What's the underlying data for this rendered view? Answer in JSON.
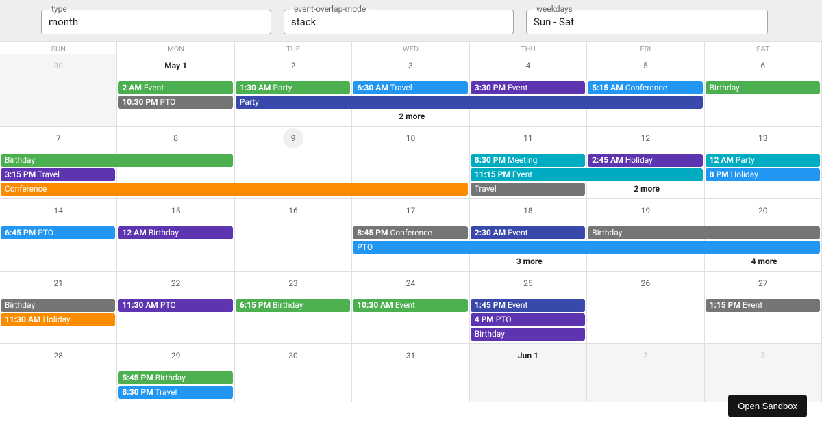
{
  "toolbar": {
    "type": {
      "label": "type",
      "value": "month"
    },
    "overlap": {
      "label": "event-overlap-mode",
      "value": "stack"
    },
    "weekdays": {
      "label": "weekdays",
      "value": "Sun - Sat"
    }
  },
  "button": {
    "sandbox": "Open Sandbox"
  },
  "weekdays": [
    "SUN",
    "MON",
    "TUE",
    "WED",
    "THU",
    "FRI",
    "SAT"
  ],
  "weeks": [
    {
      "days": [
        "30",
        "May 1",
        "2",
        "3",
        "4",
        "5",
        "6"
      ],
      "outside": [
        true,
        false,
        false,
        false,
        false,
        false,
        false
      ],
      "first": 1
    },
    {
      "days": [
        "7",
        "8",
        "9",
        "10",
        "11",
        "12",
        "13"
      ],
      "today": 2
    },
    {
      "days": [
        "14",
        "15",
        "16",
        "17",
        "18",
        "19",
        "20"
      ]
    },
    {
      "days": [
        "21",
        "22",
        "23",
        "24",
        "25",
        "26",
        "27"
      ]
    },
    {
      "days": [
        "28",
        "29",
        "30",
        "31",
        "Jun 1",
        "2",
        "3"
      ],
      "outside": [
        false,
        false,
        false,
        false,
        true,
        true,
        true
      ],
      "first": 4
    }
  ],
  "events": {
    "w0": [
      {
        "row": 0,
        "col": 1,
        "span": 1,
        "color": "green",
        "time": "2 AM",
        "title": "Event"
      },
      {
        "row": 0,
        "col": 2,
        "span": 1,
        "color": "green",
        "time": "1:30 AM",
        "title": "Party"
      },
      {
        "row": 0,
        "col": 3,
        "span": 1,
        "color": "blue2",
        "time": "6:30 AM",
        "title": "Travel"
      },
      {
        "row": 0,
        "col": 4,
        "span": 1,
        "color": "deep",
        "time": "3:30 PM",
        "title": "Event"
      },
      {
        "row": 0,
        "col": 5,
        "span": 1,
        "color": "blue2",
        "time": "5:15 AM",
        "title": "Conference"
      },
      {
        "row": 0,
        "col": 6,
        "span": 1,
        "color": "green",
        "time": "",
        "title": "Birthday"
      },
      {
        "row": 1,
        "col": 1,
        "span": 1,
        "color": "grey",
        "time": "10:30 PM",
        "title": "PTO"
      },
      {
        "row": 1,
        "col": 2,
        "span": 4,
        "color": "indigo",
        "time": "",
        "title": "Party"
      },
      {
        "row": 2,
        "col": 3,
        "span": 1,
        "more": "2 more"
      }
    ],
    "w1": [
      {
        "row": 0,
        "col": 0,
        "span": 2,
        "color": "green",
        "time": "",
        "title": "Birthday"
      },
      {
        "row": 0,
        "col": 4,
        "span": 1,
        "color": "cyan",
        "time": "8:30 PM",
        "title": "Meeting"
      },
      {
        "row": 0,
        "col": 5,
        "span": 1,
        "color": "deep",
        "time": "2:45 AM",
        "title": "Holiday"
      },
      {
        "row": 0,
        "col": 6,
        "span": 1,
        "color": "cyan",
        "time": "12 AM",
        "title": "Party"
      },
      {
        "row": 1,
        "col": 0,
        "span": 1,
        "color": "deep",
        "time": "3:15 PM",
        "title": "Travel"
      },
      {
        "row": 1,
        "col": 4,
        "span": 2,
        "color": "cyan",
        "time": "11:15 PM",
        "title": "Event"
      },
      {
        "row": 1,
        "col": 6,
        "span": 1,
        "color": "blue2",
        "time": "8 PM",
        "title": "Holiday"
      },
      {
        "row": 2,
        "col": 0,
        "span": 4,
        "color": "orange",
        "time": "",
        "title": "Conference"
      },
      {
        "row": 2,
        "col": 4,
        "span": 1,
        "color": "grey",
        "time": "",
        "title": "Travel"
      },
      {
        "row": 2,
        "col": 5,
        "span": 1,
        "more": "2 more"
      }
    ],
    "w2": [
      {
        "row": 0,
        "col": 0,
        "span": 1,
        "color": "blue2",
        "time": "6:45 PM",
        "title": "PTO"
      },
      {
        "row": 0,
        "col": 1,
        "span": 1,
        "color": "deep",
        "time": "12 AM",
        "title": "Birthday"
      },
      {
        "row": 0,
        "col": 3,
        "span": 1,
        "color": "grey",
        "time": "8:45 PM",
        "title": "Conference"
      },
      {
        "row": 0,
        "col": 4,
        "span": 1,
        "color": "indigo",
        "time": "2:30 AM",
        "title": "Event"
      },
      {
        "row": 0,
        "col": 5,
        "span": 2,
        "color": "grey",
        "time": "",
        "title": "Birthday"
      },
      {
        "row": 1,
        "col": 3,
        "span": 4,
        "color": "blue2",
        "time": "",
        "title": "PTO"
      },
      {
        "row": 2,
        "col": 4,
        "span": 1,
        "more": "3 more"
      },
      {
        "row": 2,
        "col": 6,
        "span": 1,
        "more": "4 more"
      }
    ],
    "w3": [
      {
        "row": 0,
        "col": 0,
        "span": 1,
        "color": "grey",
        "time": "",
        "title": "Birthday"
      },
      {
        "row": 0,
        "col": 1,
        "span": 1,
        "color": "deep",
        "time": "11:30 AM",
        "title": "PTO"
      },
      {
        "row": 0,
        "col": 2,
        "span": 1,
        "color": "green",
        "time": "6:15 PM",
        "title": "Birthday"
      },
      {
        "row": 0,
        "col": 3,
        "span": 1,
        "color": "green",
        "time": "10:30 AM",
        "title": "Event"
      },
      {
        "row": 0,
        "col": 4,
        "span": 1,
        "color": "indigo",
        "time": "1:45 PM",
        "title": "Event"
      },
      {
        "row": 0,
        "col": 6,
        "span": 1,
        "color": "grey",
        "time": "1:15 PM",
        "title": "Event"
      },
      {
        "row": 1,
        "col": 0,
        "span": 1,
        "color": "orange",
        "time": "11:30 AM",
        "title": "Holiday"
      },
      {
        "row": 1,
        "col": 4,
        "span": 1,
        "color": "deep",
        "time": "4 PM",
        "title": "PTO"
      },
      {
        "row": 2,
        "col": 4,
        "span": 1,
        "color": "deep",
        "time": "",
        "title": "Birthday"
      }
    ],
    "w4": [
      {
        "row": 0,
        "col": 1,
        "span": 1,
        "color": "green",
        "time": "5:45 PM",
        "title": "Birthday"
      },
      {
        "row": 1,
        "col": 1,
        "span": 1,
        "color": "blue2",
        "time": "8:30 PM",
        "title": "Travel"
      }
    ]
  }
}
